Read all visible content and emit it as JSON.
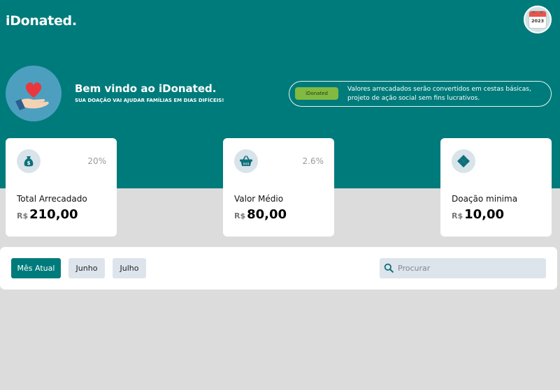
{
  "header": {
    "brand": "iDonated.",
    "calendar_year": "2023"
  },
  "hero": {
    "title": "Bem vindo ao iDonated.",
    "subtitle": "SUA DOAÇÃO VAI AJUDAR FAMÍLIAS EM DIAS DIFÍCEIS!",
    "info_badge": "iDonated",
    "info_text": "Valores arrecadados serão convertidos em cestas básicas, projeto de ação social sem fins lucrativos."
  },
  "cards": [
    {
      "icon": "money-bag-icon",
      "percent": "20%",
      "label": "Total Arrecadado",
      "currency": "R$",
      "value": "210,00"
    },
    {
      "icon": "basket-icon",
      "percent": "2.6%",
      "label": "Valor Médio",
      "currency": "R$",
      "value": "80,00"
    },
    {
      "icon": "diamond-icon",
      "percent": "",
      "label": "Doação minima",
      "currency": "R$",
      "value": "10,00"
    }
  ],
  "filters": {
    "tabs": [
      "Mês Atual",
      "Junho",
      "Julho"
    ],
    "active_tab": "Mês Atual",
    "search_placeholder": "Procurar"
  },
  "colors": {
    "primary": "#007b7b",
    "accent_green": "#82b940",
    "icon_bg": "#d8e3ea"
  }
}
